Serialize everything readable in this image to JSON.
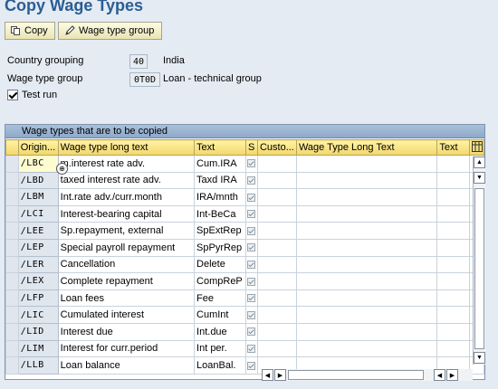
{
  "title": "Copy Wage Types",
  "toolbar": {
    "copy_label": "Copy",
    "wage_type_group_label": "Wage type group"
  },
  "fields": {
    "country_grouping": {
      "label": "Country grouping",
      "value": "40",
      "desc": "India"
    },
    "wage_type_group": {
      "label": "Wage type group",
      "value": "0T0D",
      "desc": "Loan - technical group"
    }
  },
  "test_run": {
    "label": "Test run",
    "checked": true
  },
  "table": {
    "caption": "Wage types that are to be copied",
    "columns": [
      "Origin...",
      "Wage type long text",
      "Text",
      "S",
      "Custo...",
      "Wage Type Long Text",
      "Text"
    ],
    "rows": [
      {
        "origin": "/LBC",
        "long_text": "m.interest rate adv.",
        "text": "Cum.IRA"
      },
      {
        "origin": "/LBD",
        "long_text": "taxed interest rate adv.",
        "text": "Taxd IRA"
      },
      {
        "origin": "/LBM",
        "long_text": "Int.rate adv./curr.month",
        "text": "IRA/mnth"
      },
      {
        "origin": "/LCI",
        "long_text": "Interest-bearing capital",
        "text": "Int-BeCa"
      },
      {
        "origin": "/LEE",
        "long_text": "Sp.repayment, external",
        "text": "SpExtRep"
      },
      {
        "origin": "/LEP",
        "long_text": "Special payroll repayment",
        "text": "SpPyrRep"
      },
      {
        "origin": "/LER",
        "long_text": "Cancellation",
        "text": "Delete"
      },
      {
        "origin": "/LEX",
        "long_text": "Complete repayment",
        "text": "CompReP"
      },
      {
        "origin": "/LFP",
        "long_text": "Loan fees",
        "text": "Fee"
      },
      {
        "origin": "/LIC",
        "long_text": "Cumulated interest",
        "text": "CumInt"
      },
      {
        "origin": "/LID",
        "long_text": "Interest due",
        "text": "Int.due"
      },
      {
        "origin": "/LIM",
        "long_text": "Interest for curr.period",
        "text": "Int per."
      },
      {
        "origin": "/LLB",
        "long_text": "Loan balance",
        "text": "LoanBal."
      }
    ]
  },
  "icons": {
    "copy": "copy-icon",
    "pencil": "pencil-icon",
    "column_settings": "table-settings-icon"
  },
  "colors": {
    "title": "#2a5d95",
    "header_yellow": "#f2d66b",
    "caption_blue": "#8eaac9",
    "background": "#e5ebf3"
  }
}
